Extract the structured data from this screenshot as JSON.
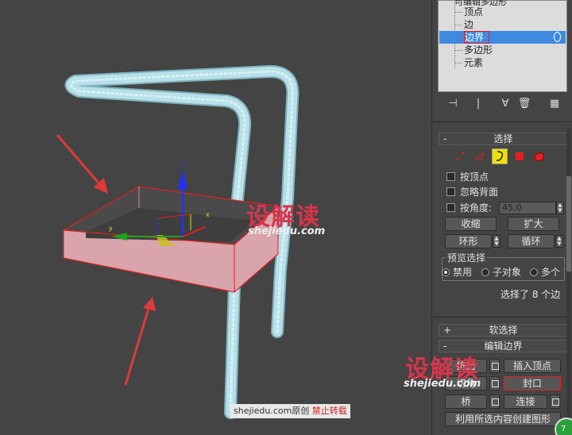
{
  "tree": {
    "top_label": "可编辑多边形",
    "items": [
      {
        "label": "顶点",
        "selected": false
      },
      {
        "label": "边",
        "selected": false
      },
      {
        "label": "边界",
        "selected": true
      },
      {
        "label": "多边形",
        "selected": false
      },
      {
        "label": "元素",
        "selected": false
      }
    ]
  },
  "toolbar": {
    "icons": [
      "pin-stack-icon",
      "show-end-result-icon",
      "make-unique-icon",
      "remove-modifier-icon",
      "configure-modifier-sets-icon"
    ],
    "glyphs": [
      "⊣",
      "|",
      "∀",
      "🗑",
      "▦"
    ]
  },
  "selection": {
    "title": "选择",
    "by_vertex": "按顶点",
    "ignore_backfacing": "忽略背面",
    "by_angle": "按角度:",
    "angle_value": "45.0",
    "shrink": "收缩",
    "grow": "扩大",
    "ring": "环形",
    "loop": "循环",
    "preview_title": "预览选择",
    "preview_options": [
      "禁用",
      "子对象",
      "多个"
    ],
    "status": "选择了 8 个边"
  },
  "soft_selection": {
    "title": "软选择",
    "sign": "+"
  },
  "edit_borders": {
    "title": "编辑边界",
    "sign": "-",
    "extrude": "挤出",
    "insert_vertex": "插入顶点",
    "chamfer": "切角",
    "cap": "封口",
    "bridge": "桥",
    "connect": "连接",
    "create_shape": "利用所选内容创建图形"
  },
  "watermark": {
    "brand": "设解读",
    "url": "shejiedu.com",
    "credit_prefix": "shejiedu.com原创",
    "credit_red": "禁止转载"
  },
  "colors": {
    "viewport_bg": "#444444",
    "pipe": "#a9d6df",
    "selection_red": "#e02020",
    "highlight_blue": "#3d8ae0",
    "active_yellow": "#f0e000",
    "arrow_red": "#e03a3a"
  }
}
